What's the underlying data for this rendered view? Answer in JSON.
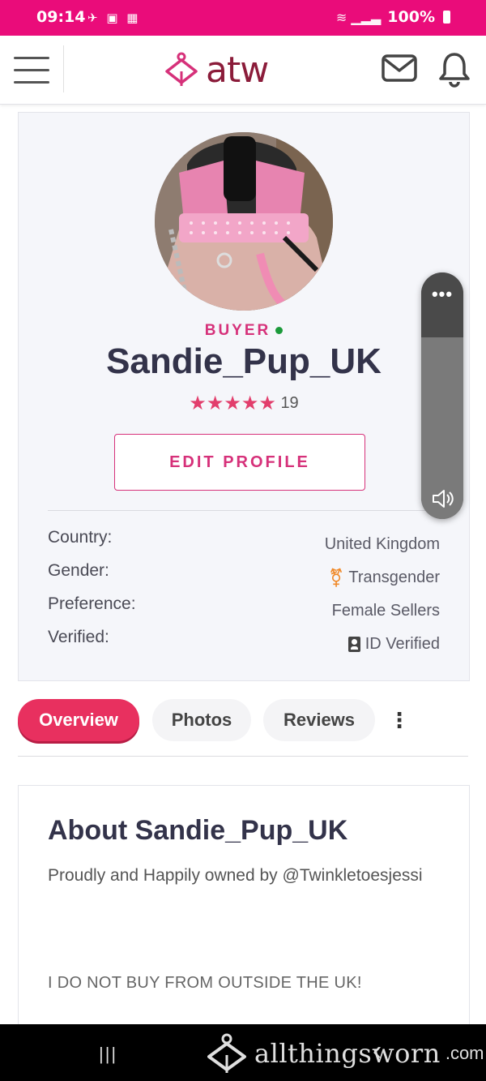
{
  "status_bar": {
    "time": "09:14",
    "battery": "100%"
  },
  "header": {
    "logo_text": "atw"
  },
  "profile": {
    "role": "BUYER",
    "username": "Sandie_Pup_UK",
    "stars": "★★★★★",
    "rating_count": "19",
    "edit_button": "EDIT PROFILE",
    "details": [
      {
        "label": "Country:",
        "value": "United Kingdom"
      },
      {
        "label": "Gender:",
        "value": "Transgender"
      },
      {
        "label": "Preference:",
        "value": "Female Sellers"
      },
      {
        "label": "Verified:",
        "value": "ID Verified"
      }
    ]
  },
  "tabs": [
    {
      "label": "Overview",
      "active": true
    },
    {
      "label": "Photos",
      "active": false
    },
    {
      "label": "Reviews",
      "active": false
    }
  ],
  "tabs_more": "⋮",
  "about": {
    "title": "About Sandie_Pup_UK",
    "bio": "Proudly and Happily owned by @Twinkletoesjessi",
    "note": "I DO NOT BUY FROM OUTSIDE THE UK!"
  },
  "volume_panel": {
    "menu": "•••"
  },
  "watermark": {
    "text": "allthingsworn",
    "suffix": ".com"
  },
  "colors": {
    "brand_pink": "#ea0c7a",
    "accent": "#e8305f",
    "logo": "#8b1c3a"
  }
}
